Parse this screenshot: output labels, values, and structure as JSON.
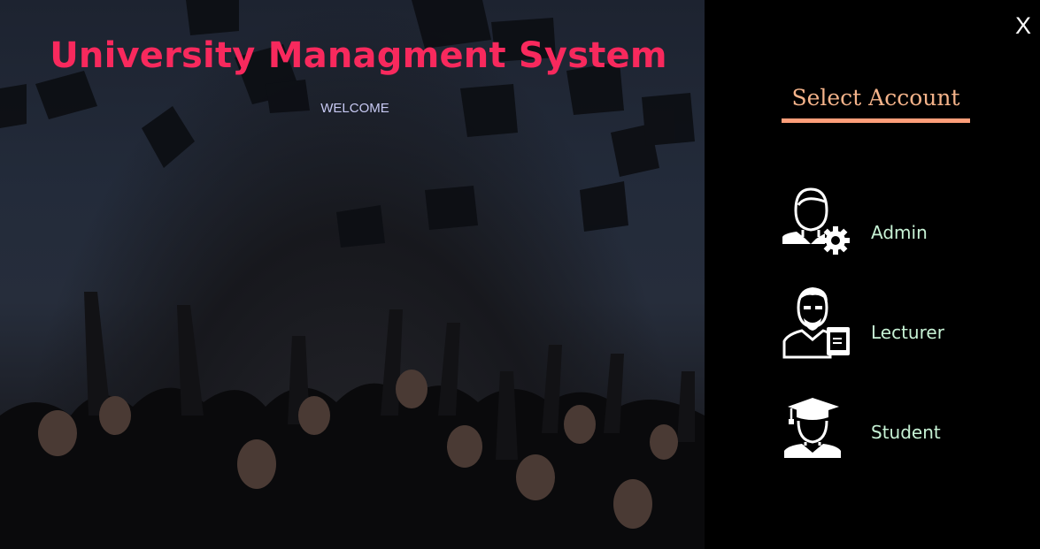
{
  "hero": {
    "title": "University Managment System",
    "subtitle": "WELCOME"
  },
  "panel": {
    "close_label": "X",
    "heading": "Select Account",
    "accounts": [
      {
        "label": "Admin",
        "icon": "admin-gear-icon"
      },
      {
        "label": "Lecturer",
        "icon": "lecturer-icon"
      },
      {
        "label": "Student",
        "icon": "graduate-student-icon"
      }
    ]
  },
  "colors": {
    "title": "#f8295d",
    "heading": "#f4b38a",
    "underline": "#ff9e7a",
    "account_label": "#c7f2d5",
    "panel_bg": "#000000"
  }
}
